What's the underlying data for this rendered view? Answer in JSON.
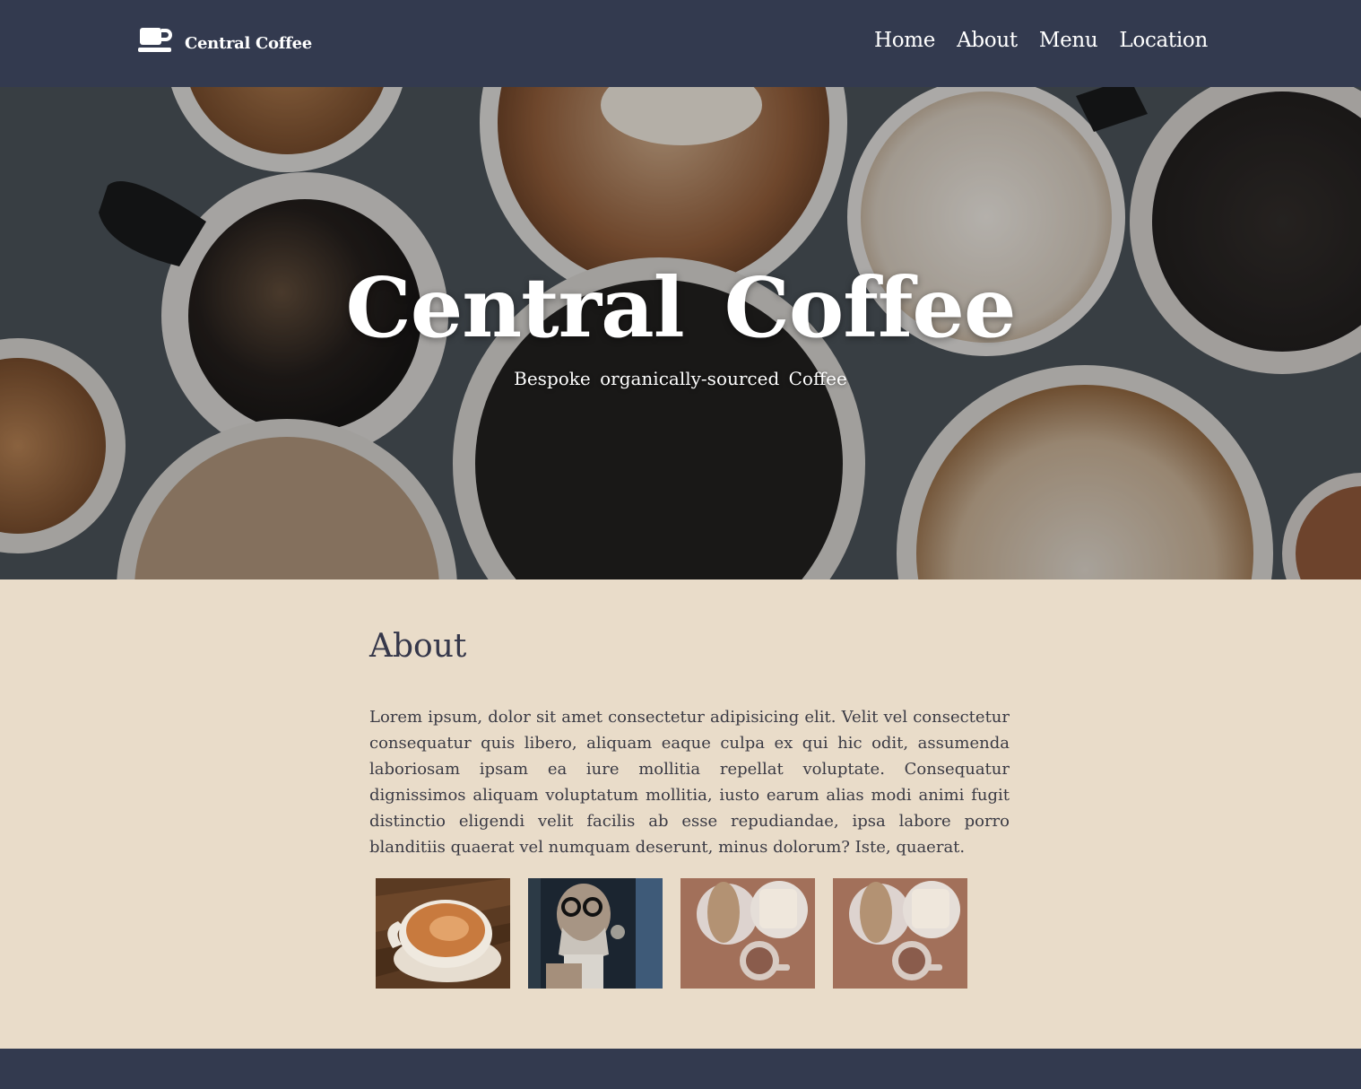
{
  "nav": {
    "brand": "Central Coffee",
    "brand_icon": "coffee-cup-icon",
    "links": [
      "Home",
      "About",
      "Menu",
      "Location"
    ]
  },
  "hero": {
    "title": "Central Coffee",
    "subtitle": "Bespoke organically-sourced Coffee"
  },
  "about": {
    "heading": "About",
    "body": "Lorem ipsum, dolor sit amet consectetur adipisicing elit. Velit vel consectetur consequatur quis libero, aliquam eaque culpa ex qui hic odit, assumenda laboriosam ipsam ea iure mollitia repellat voluptate. Consequatur dignissimos aliquam voluptatum mollitia, iusto earum alias modi animi fugit distinctio eligendi velit facilis ab esse repudiandae, ipsa labore porro blanditiis quaerat vel numquam deserunt, minus dolorum? Iste, quaerat."
  },
  "gallery": [
    "cappuccino-photo",
    "man-with-mug-photo",
    "toast-and-coffee-photo",
    "toast-and-coffee-photo"
  ],
  "colors": {
    "navbar": "#333a4f",
    "page_background": "#e9dcc9",
    "heading": "#35374a"
  }
}
